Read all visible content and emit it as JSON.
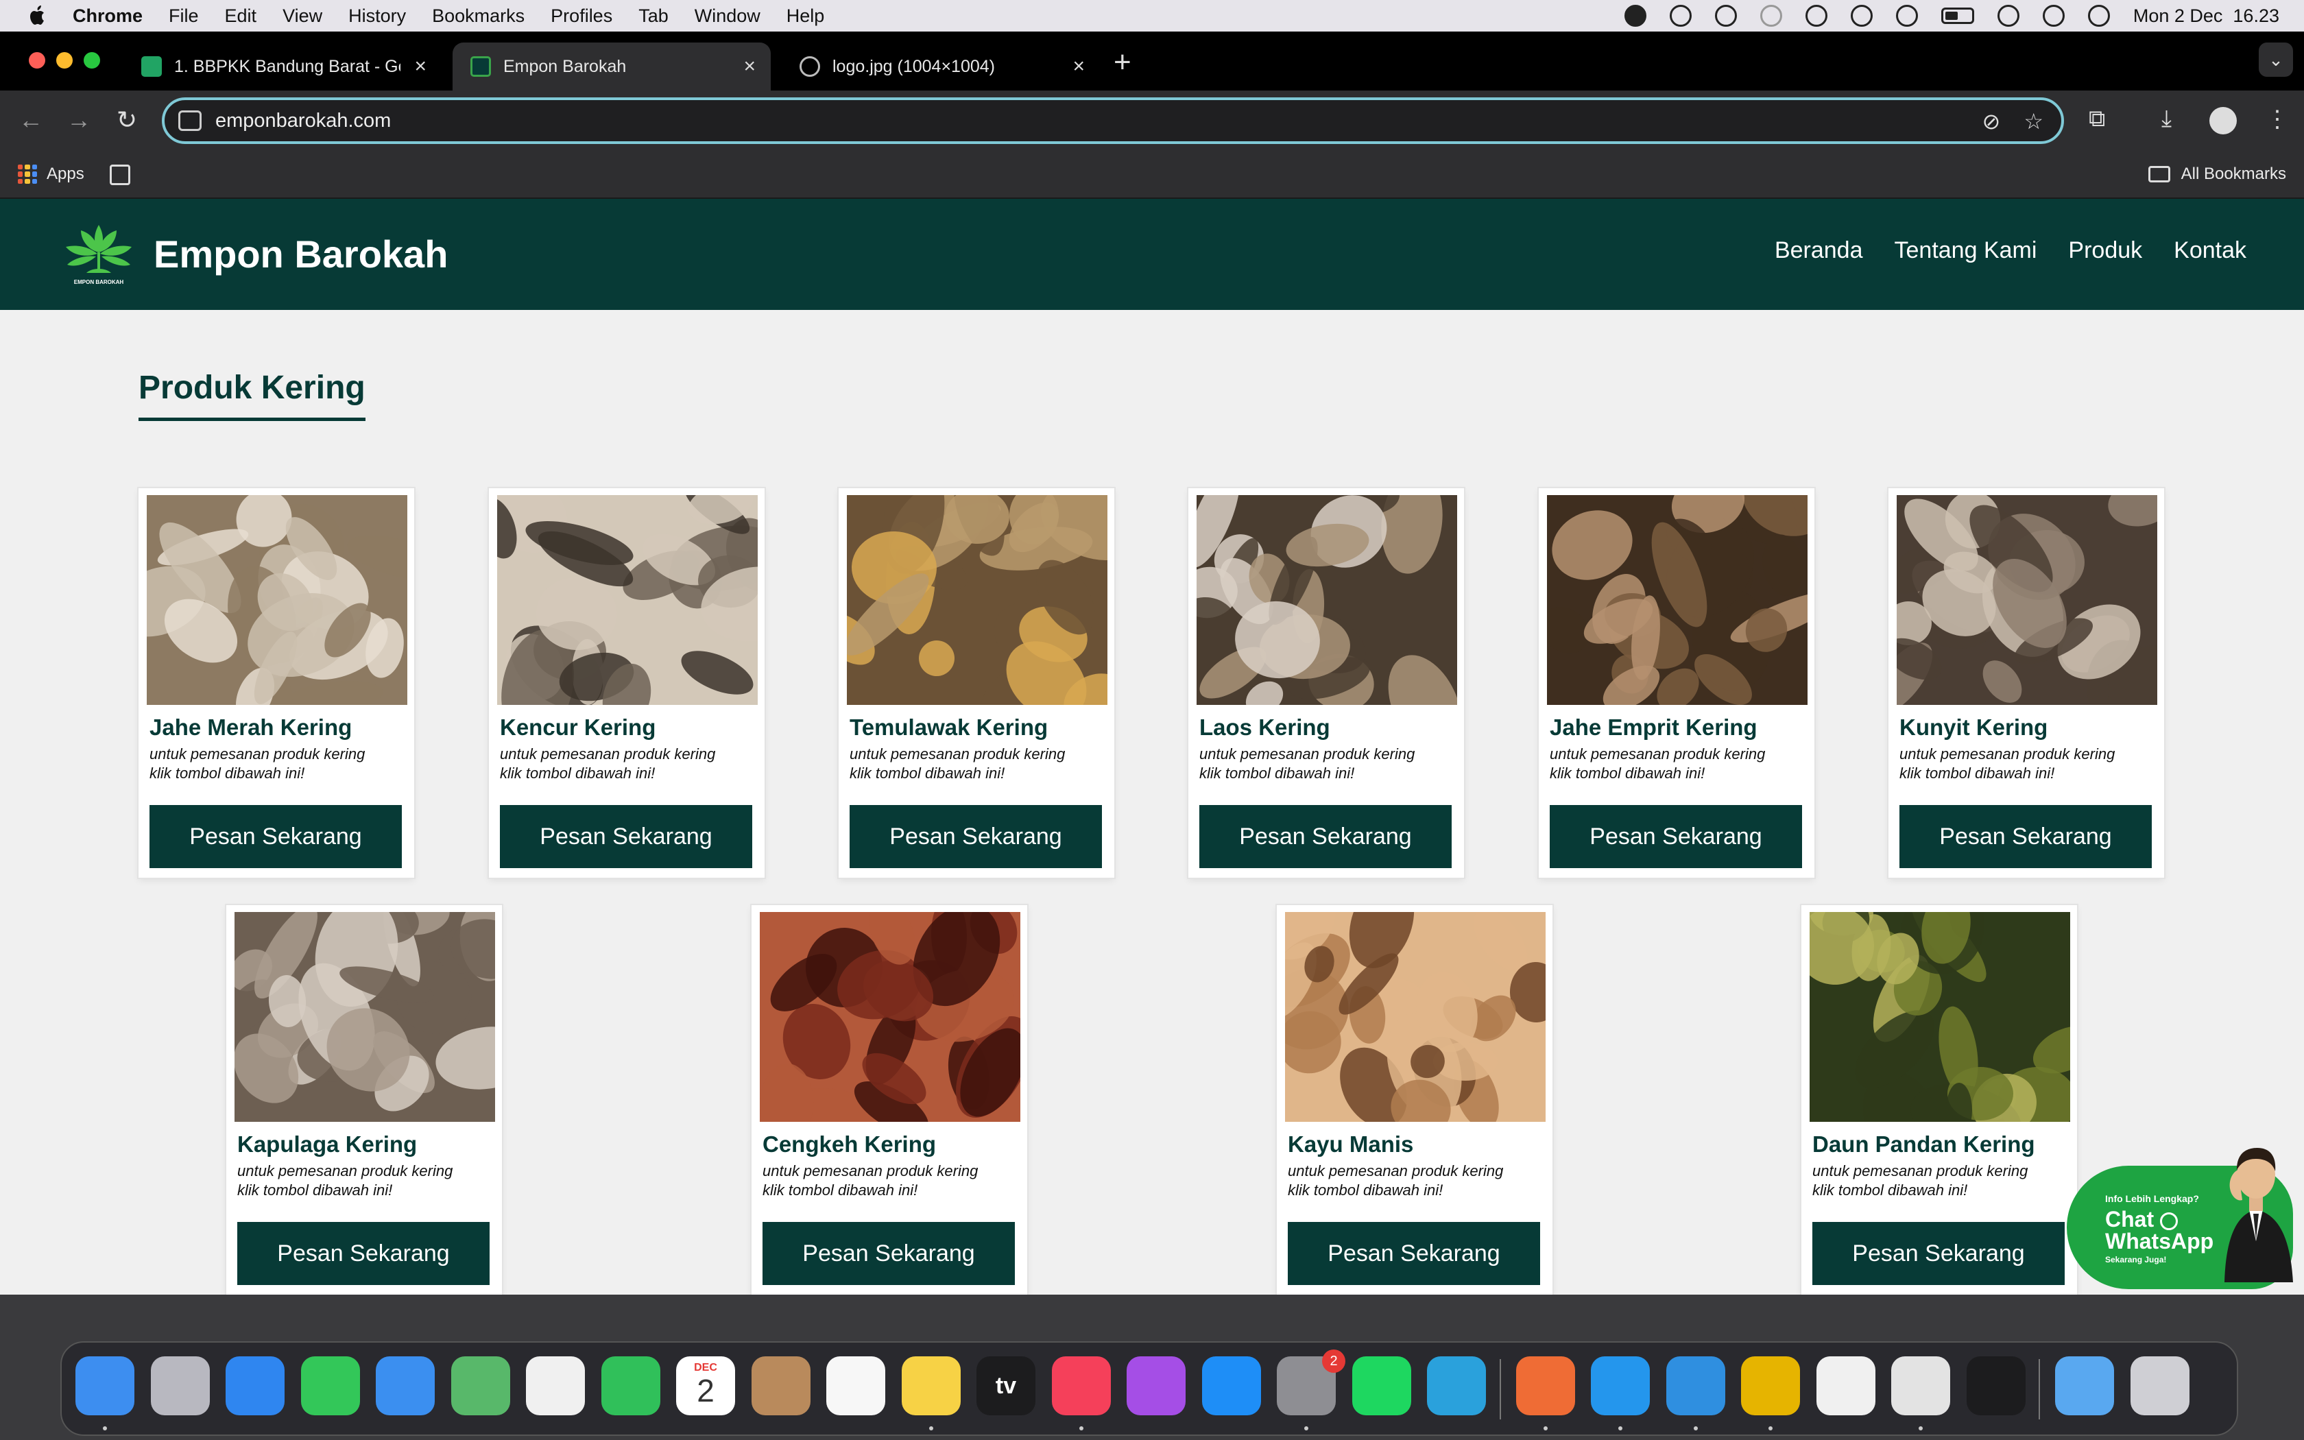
{
  "menubar": {
    "app_name": "Chrome",
    "items": [
      "File",
      "Edit",
      "View",
      "History",
      "Bookmarks",
      "Profiles",
      "Tab",
      "Window",
      "Help"
    ],
    "clock": "Mon 2 Dec  16.23"
  },
  "tabs": [
    {
      "title": "1. BBPKK Bandung Barat - Go",
      "favicon": "sheets-icon",
      "color": "#21a464"
    },
    {
      "title": "Empon Barokah",
      "favicon": "leaf-icon",
      "color": "#3aa44a"
    },
    {
      "title": "logo.jpg (1004×1004)",
      "favicon": "globe-icon",
      "color": "#bbbbbb"
    }
  ],
  "address_bar": {
    "url": "emponbarokah.com"
  },
  "bookmarks": {
    "apps_label": "Apps",
    "all_label": "All Bookmarks"
  },
  "site": {
    "brand": "Empon Barokah",
    "logo_caption": "EMPON BAROKAH",
    "nav": [
      "Beranda",
      "Tentang Kami",
      "Produk",
      "Kontak"
    ],
    "section_title": "Produk Kering",
    "product_desc_1": "untuk pemesanan produk kering",
    "product_desc_2": "klik tombol dibawah ini!",
    "order_button": "Pesan Sekarang",
    "products": [
      {
        "name": "Jahe Merah Kering",
        "colors": [
          "#cbbfae",
          "#8d7a62",
          "#e6ddd0"
        ]
      },
      {
        "name": "Kencur Kering",
        "colors": [
          "#6e6356",
          "#d3c8b8",
          "#3c342c"
        ]
      },
      {
        "name": "Temulawak Kering",
        "colors": [
          "#b89a6c",
          "#6b5236",
          "#d8a851"
        ]
      },
      {
        "name": "Laos Kering",
        "colors": [
          "#a99378",
          "#4a3d30",
          "#d9cfc4"
        ]
      },
      {
        "name": "Jahe Emprit Kering",
        "colors": [
          "#7a5c3e",
          "#3f2e1f",
          "#b59070"
        ]
      },
      {
        "name": "Kunyit Kering",
        "colors": [
          "#8f7f70",
          "#4b3e34",
          "#cdbfb0"
        ]
      },
      {
        "name": "Kapulaga Kering",
        "colors": [
          "#a99b8d",
          "#6d5f52",
          "#d6cdc2"
        ]
      },
      {
        "name": "Cengkeh Kering",
        "colors": [
          "#7a2a1c",
          "#b3593a",
          "#3e120c"
        ]
      },
      {
        "name": "Kayu Manis",
        "colors": [
          "#b07c4f",
          "#e0b68a",
          "#6e4528"
        ]
      },
      {
        "name": "Daun Pandan Kering",
        "colors": [
          "#6f7a2c",
          "#2e3a1a",
          "#b4b25a"
        ]
      }
    ]
  },
  "whatsapp": {
    "small": "Info Lebih Lengkap?",
    "chat": "Chat",
    "whatsapp": "WhatsApp",
    "sub": "Sekarang Juga!"
  },
  "dock": {
    "apps": [
      {
        "name": "finder-icon",
        "color": "#3d8ef0"
      },
      {
        "name": "launchpad-icon",
        "color": "#b8b8c0"
      },
      {
        "name": "safari-icon",
        "color": "#2f86f0"
      },
      {
        "name": "messages-icon",
        "color": "#33c759"
      },
      {
        "name": "mail-icon",
        "color": "#3b8ff0"
      },
      {
        "name": "maps-icon",
        "color": "#58b86a"
      },
      {
        "name": "photos-icon",
        "color": "#f0f0f0"
      },
      {
        "name": "facetime-icon",
        "color": "#30c05a"
      },
      {
        "name": "calendar-icon",
        "color": "#ffffff"
      },
      {
        "name": "contacts-icon",
        "color": "#b98a5c"
      },
      {
        "name": "reminders-icon",
        "color": "#f7f7f7"
      },
      {
        "name": "notes-icon",
        "color": "#f7d245"
      },
      {
        "name": "tv-icon",
        "color": "#1c1c1e"
      },
      {
        "name": "music-icon",
        "color": "#f5405a"
      },
      {
        "name": "podcasts-icon",
        "color": "#a54ee6"
      },
      {
        "name": "app-store-icon",
        "color": "#1e8ef7"
      },
      {
        "name": "system-settings-icon",
        "color": "#8e8e93"
      },
      {
        "name": "spotify-icon",
        "color": "#1ed760"
      },
      {
        "name": "telegram-icon",
        "color": "#2aa1dc"
      },
      {
        "name": "postman-icon",
        "color": "#ef6c35"
      },
      {
        "name": "docker-icon",
        "color": "#2496ed"
      },
      {
        "name": "vscode-icon",
        "color": "#2f8fe0"
      },
      {
        "name": "navicat-icon",
        "color": "#e6b400"
      },
      {
        "name": "textedit-icon",
        "color": "#f0f0f0"
      },
      {
        "name": "chrome-icon",
        "color": "#e3e3e3"
      },
      {
        "name": "terminal-icon",
        "color": "#1c1c1e"
      },
      {
        "name": "downloads-folder-icon",
        "color": "#59a8f0"
      },
      {
        "name": "trash-icon",
        "color": "#cfcfd4"
      }
    ],
    "calendar_month": "DEC",
    "calendar_day": "2",
    "tv_label": "tv",
    "settings_badge": "2"
  }
}
